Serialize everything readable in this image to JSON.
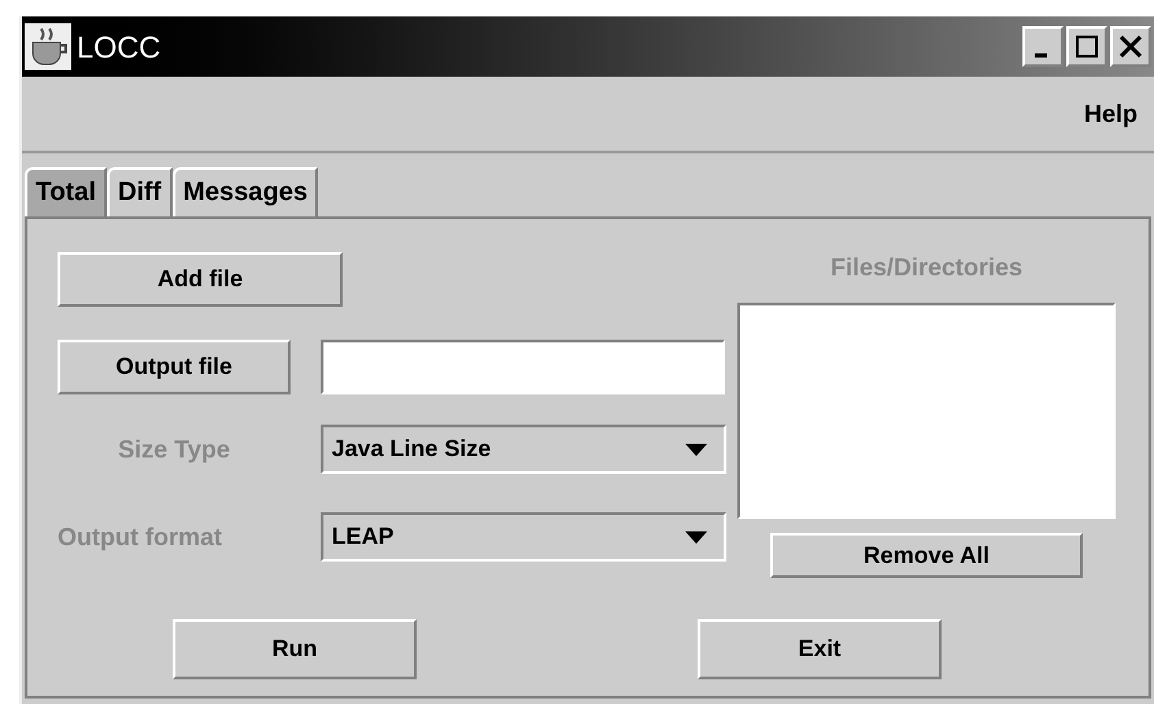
{
  "window": {
    "title": "LOCC"
  },
  "menu": [
    "Help"
  ],
  "tabs": [
    {
      "label": "Total",
      "selected": true
    },
    {
      "label": "Diff",
      "selected": false
    },
    {
      "label": "Messages",
      "selected": false
    }
  ],
  "add_button": "Add file",
  "output_file": {
    "button": "Output file"
  },
  "size_type": {
    "label": "Size Type",
    "value": "Java Line Size"
  },
  "output_format": {
    "label": "Output format",
    "value": "LEAP"
  },
  "files": {
    "heading": "Files/Directories",
    "button": "Remove All"
  },
  "buttons": [
    "Run",
    "Exit"
  ]
}
